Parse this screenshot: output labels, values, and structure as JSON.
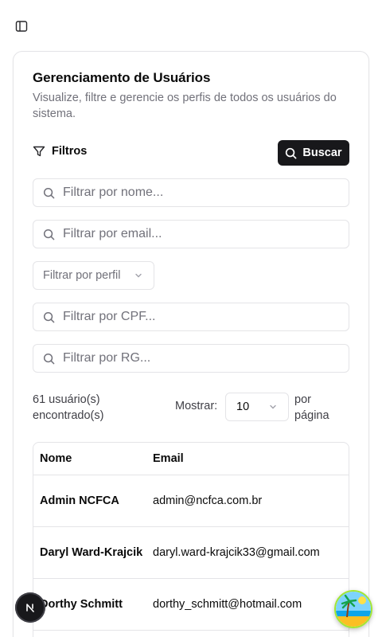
{
  "header": {
    "sidebar_toggle_icon": "panel-left-icon"
  },
  "card": {
    "title": "Gerenciamento de Usuários",
    "subtitle": "Visualize, filtre e gerencie os perfis de todos os usuários do sistema."
  },
  "filters": {
    "label": "Filtros",
    "search_button": "Buscar",
    "name_placeholder": "Filtrar por nome...",
    "email_placeholder": "Filtrar por email...",
    "profile_select": "Filtrar por perfil",
    "cpf_placeholder": "Filtrar por CPF...",
    "rg_placeholder": "Filtrar por RG..."
  },
  "results": {
    "count_line1": "61 usuário(s)",
    "count_line2": "encontrado(s)",
    "show_label": "Mostrar:",
    "page_size": "10",
    "per_page_line1": "por",
    "per_page_line2": "página"
  },
  "table": {
    "headers": {
      "name": "Nome",
      "email": "Email"
    },
    "rows": [
      {
        "name": "Admin NCFCA",
        "email": "admin@ncfca.com.br"
      },
      {
        "name": "Daryl Ward-Krajcik",
        "email": "daryl.ward-krajcik33@gmail.com"
      },
      {
        "name": "Dorthy Schmitt",
        "email": "dorthy_schmitt@hotmail.com"
      }
    ]
  },
  "floating": {
    "left_button_icon": "next-logo-icon",
    "right_button_icon": "beach-avatar-icon"
  },
  "colors": {
    "primary": "#18181b",
    "border": "#e4e4e7",
    "muted_text": "#71717a"
  }
}
